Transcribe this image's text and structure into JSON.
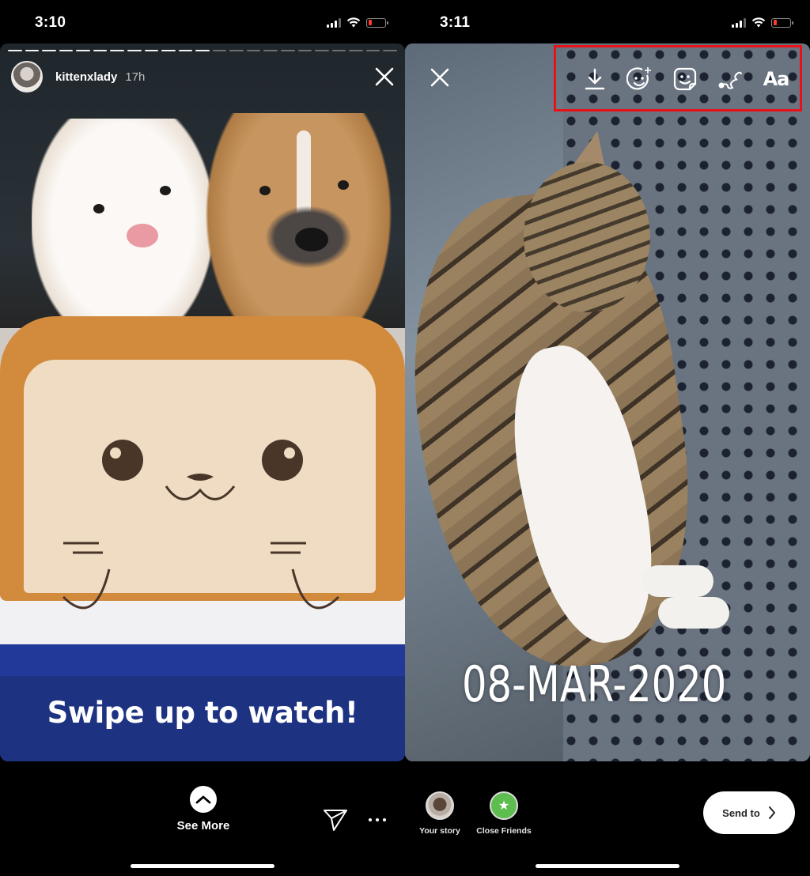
{
  "left_screen": {
    "status_bar": {
      "time": "3:10",
      "battery_level": "low"
    },
    "story": {
      "progress": {
        "total_segments": 23,
        "completed_segments": 12
      },
      "username": "kittenxlady",
      "time_ago": "17h",
      "close_icon": "close-icon",
      "photo_description": "two puppies in a bread-shaped cat pet bed",
      "banner_text": "Swipe up to watch!",
      "banner_color": "#1d3382"
    },
    "bottom_bar": {
      "see_more_label": "See More",
      "send_icon": "paper-plane-icon",
      "more_icon": "ellipsis-icon"
    }
  },
  "right_screen": {
    "status_bar": {
      "time": "3:11",
      "battery_level": "low"
    },
    "editor": {
      "close_icon": "close-icon",
      "tools": [
        {
          "name": "download",
          "icon": "download-icon"
        },
        {
          "name": "effects",
          "icon": "face-sparkle-icon"
        },
        {
          "name": "sticker",
          "icon": "sticker-icon"
        },
        {
          "name": "draw",
          "icon": "squiggle-pen-icon"
        },
        {
          "name": "text",
          "label": "Aa"
        }
      ],
      "highlight_color": "#e8111a",
      "photo_description": "tabby cat sleeping on polka-dot blanket",
      "date_sticker": "08-MAR-2020"
    },
    "bottom_bar": {
      "share_targets": [
        {
          "label": "Your story"
        },
        {
          "label": "Close Friends",
          "icon": "star-icon",
          "color": "#5ebd4f"
        }
      ],
      "send_to_label": "Send to"
    }
  }
}
